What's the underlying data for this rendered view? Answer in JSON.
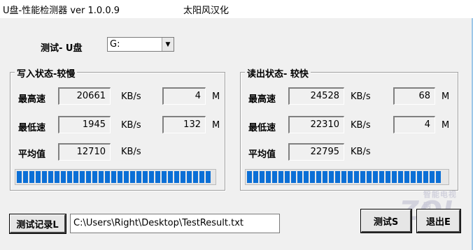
{
  "window": {
    "title": "U盘-性能检测器  ver 1.0.0.9",
    "credit": "太阳风汉化"
  },
  "drive": {
    "label": "测试- U盘",
    "selected": "G:"
  },
  "write_group": {
    "title": "写入状态-较慢",
    "max_label": "最高速",
    "max_value": "20661",
    "max_unit": "KB/s",
    "max_size": "4",
    "max_size_unit": "M",
    "min_label": "最低速",
    "min_value": "1945",
    "min_unit": "KB/s",
    "min_size": "132",
    "min_size_unit": "M",
    "avg_label": "平均值",
    "avg_value": "12710",
    "avg_unit": "KB/s",
    "progress": 1.0
  },
  "read_group": {
    "title": "读出状态- 较快",
    "max_label": "最高速",
    "max_value": "24528",
    "max_unit": "KB/s",
    "max_size": "68",
    "max_size_unit": "M",
    "min_label": "最低速",
    "min_value": "22310",
    "min_unit": "KB/s",
    "min_size": "4",
    "min_size_unit": "M",
    "avg_label": "平均值",
    "avg_value": "22795",
    "avg_unit": "KB/s",
    "progress": 1.0
  },
  "footer": {
    "log_button": "测试记录L",
    "log_path": "C:\\Users\\Right\\Desktop\\TestResult.txt",
    "test_button": "测试S",
    "exit_button": "退出E"
  },
  "watermark": {
    "text": "ZOL",
    "subtext": "智能电视网"
  },
  "colors": {
    "progress": "#0b6fd6",
    "background": "#f0f0f0"
  }
}
